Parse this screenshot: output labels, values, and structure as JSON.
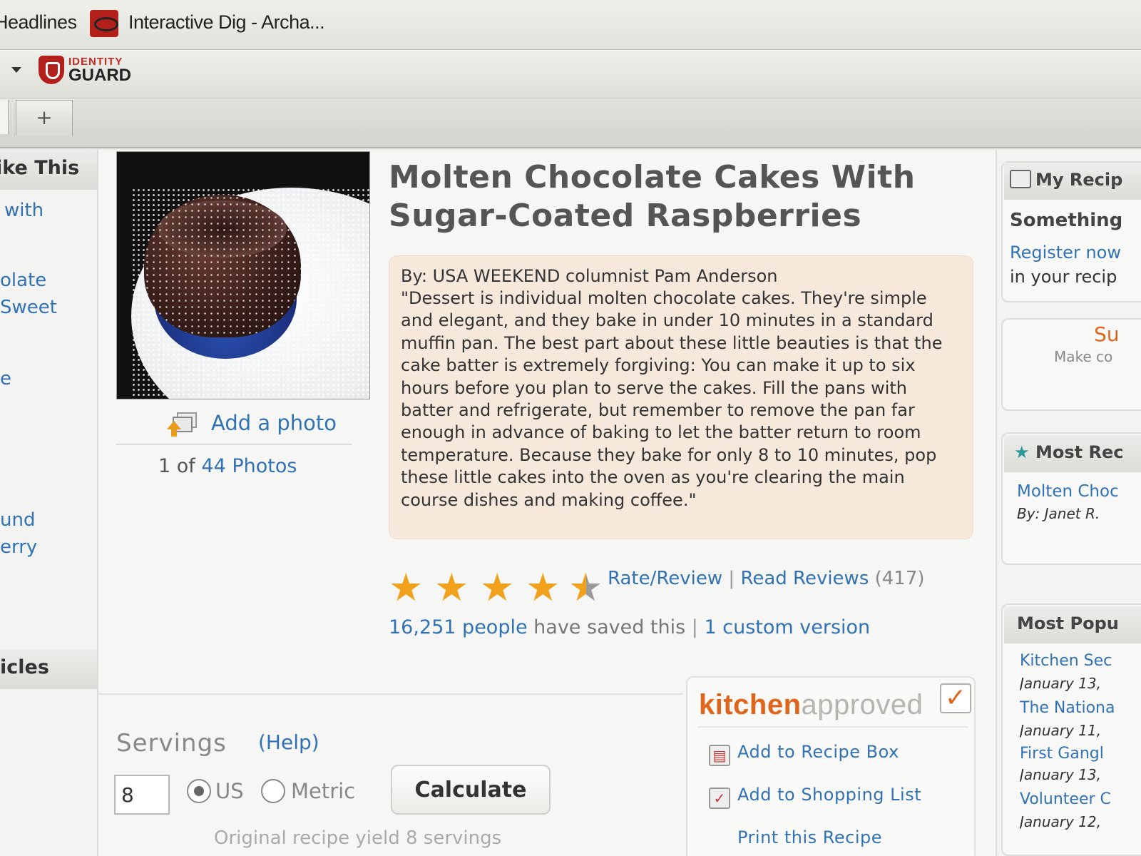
{
  "browser": {
    "bookmarks": [
      "Headlines",
      "Interactive Dig - Archa..."
    ],
    "toolbar": {
      "logo_top": "IDENTITY",
      "logo_bottom": "GUARD"
    },
    "new_tab": "+"
  },
  "left_sidebar": {
    "heading_1": "ike This",
    "links": [
      "with",
      "olate",
      "Sweet",
      "e",
      "und",
      "erry"
    ],
    "heading_2": "icles"
  },
  "photo": {
    "add_photo": "Add a photo",
    "count_prefix": "1 of",
    "count_link": "44 Photos"
  },
  "recipe": {
    "title": "Molten Chocolate Cakes With Sugar-Coated Raspberries",
    "byline": "By: USA WEEKEND columnist Pam Anderson",
    "description": "\"Dessert is individual molten chocolate cakes. They're simple and elegant, and they bake in under 10 minutes in a standard muffin pan. The best part about these little beauties is that the cake batter is extremely forgiving: You can make it up to six hours before you plan to serve the cakes. Fill the pans with batter and refrigerate, but remember to remove the pan far enough in advance of baking to let the batter return to room temperature. Because they bake for only 8 to 10 minutes, pop these little cakes into the oven as you're clearing the main course dishes and making coffee.\""
  },
  "rating": {
    "stars": 4.5,
    "star_color": "#f0a21d",
    "rate_review": "Rate/Review",
    "separator": "|",
    "read_reviews": "Read Reviews",
    "review_count": "(417)",
    "saved_link": "16,251 people",
    "saved_text": "have saved this",
    "custom_version": "1 custom version"
  },
  "servings": {
    "label": "Servings",
    "help": "(Help)",
    "value": "8",
    "unit_us": "US",
    "unit_metric": "Metric",
    "selected_unit": "US",
    "calculate": "Calculate",
    "yield_note": "Original recipe yield 8 servings"
  },
  "kitchen_approved": {
    "brand_1": "kitchen",
    "brand_2": "approved",
    "check": "✓",
    "items": [
      "Add to Recipe Box",
      "Add to Shopping List",
      "Print this Recipe"
    ]
  },
  "right_sidebar": {
    "my_recipes_title": "My Recip",
    "something": "Something",
    "register_1": "Register now",
    "register_2": "in your recip",
    "promo_red": "Su",
    "promo_grey": "Make co",
    "most_recent_title": "Most Rec",
    "recent_link": "Molten Choc",
    "recent_by": "By: Janet R.",
    "most_popular_title": "Most Popu",
    "popular": [
      {
        "title": "Kitchen Sec",
        "date": "January 13,"
      },
      {
        "title": "The Nationa",
        "date": "January 11,"
      },
      {
        "title": "First Gangl",
        "date": "January 13,"
      },
      {
        "title": "Volunteer C",
        "date": "January 12,"
      }
    ]
  },
  "colors": {
    "link": "#3172b5",
    "accent_orange": "#e0651c",
    "desc_bg": "#f7e8dc"
  }
}
